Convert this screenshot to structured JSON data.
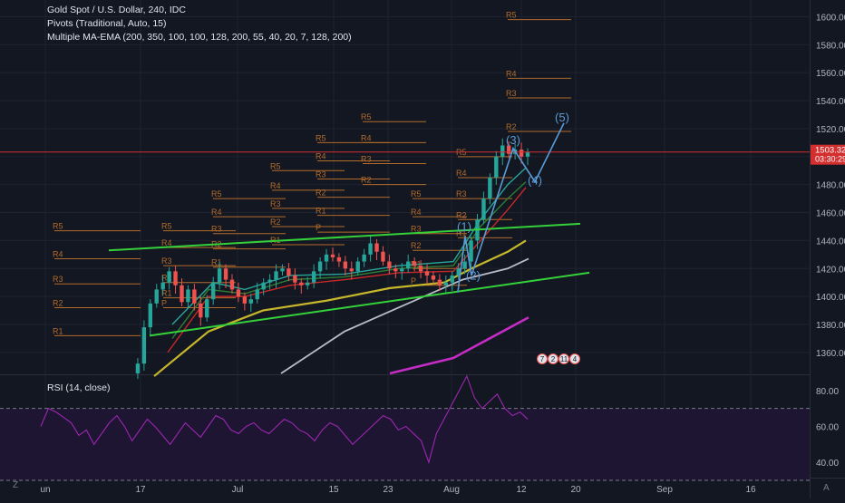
{
  "legend": {
    "symbol": "Gold Spot / U.S. Dollar, 240, IDC",
    "pivots": "Pivots (Traditional, Auto, 15)",
    "ma": "Multiple MA-EMA (200, 350, 100, 100, 128, 200, 55, 40, 20, 7, 128, 200)"
  },
  "rsi_legend": "RSI (14, close)",
  "price_badge": {
    "price": "1503.32",
    "countdown": "03:30:29"
  },
  "corner": {
    "left": "Z",
    "right": "A"
  },
  "event_badges": [
    "7",
    "2",
    "11",
    "4"
  ],
  "colors": {
    "background": "#131722",
    "up": "#26a69a",
    "down": "#ef5350",
    "pivot": "#b36b2a",
    "trend_green": "#34d13a",
    "wave_blue": "#5b9bd5",
    "rsi_line": "#9c27b0"
  },
  "chart_data": [
    {
      "type": "line",
      "title": "Gold Spot / U.S. Dollar, 240, IDC",
      "y_ticks": [
        "1600.00",
        "1580.00",
        "1560.00",
        "1540.00",
        "1520.00",
        "1500.00",
        "1480.00",
        "1460.00",
        "1440.00",
        "1420.00",
        "1400.00",
        "1380.00",
        "1360.00"
      ],
      "ylim": [
        1345,
        1612
      ],
      "x_ticks": [
        "un",
        "17",
        "Jul",
        "15",
        "23",
        "Aug",
        "12",
        "20",
        "Sep",
        "16"
      ],
      "last_price": 1503.32,
      "close_series": [
        1345,
        1352,
        1378,
        1395,
        1405,
        1410,
        1418,
        1408,
        1396,
        1405,
        1395,
        1385,
        1398,
        1410,
        1420,
        1412,
        1405,
        1400,
        1395,
        1398,
        1405,
        1410,
        1412,
        1418,
        1420,
        1415,
        1410,
        1408,
        1410,
        1418,
        1425,
        1430,
        1428,
        1425,
        1420,
        1418,
        1425,
        1430,
        1438,
        1432,
        1425,
        1420,
        1418,
        1420,
        1425,
        1422,
        1418,
        1415,
        1412,
        1408,
        1410,
        1415,
        1420,
        1425,
        1440,
        1455,
        1470,
        1485,
        1500,
        1508,
        1502,
        1505,
        1500,
        1503
      ],
      "wave_labels": [
        "(1)",
        "(2)",
        "(3)",
        "(4)",
        "(5)"
      ],
      "wave_points": [
        [
          1425,
          1447
        ],
        [
          1413,
          1412
        ],
        [
          1501,
          1509
        ],
        [
          1481,
          1480
        ],
        [
          1522,
          1525
        ]
      ],
      "pivot_labels": [
        "R5",
        "R4",
        "R3",
        "R2",
        "R1",
        "P",
        "S1",
        "S2",
        "S3",
        "S4",
        "S5"
      ],
      "grid": true
    },
    {
      "type": "line",
      "title": "RSI (14, close)",
      "y_ticks": [
        "80.00",
        "60.00",
        "40.00"
      ],
      "ylim": [
        32,
        88
      ],
      "bands": [
        70,
        30
      ],
      "values": [
        60,
        70,
        68,
        65,
        62,
        55,
        58,
        50,
        56,
        62,
        66,
        60,
        52,
        58,
        64,
        60,
        55,
        50,
        56,
        62,
        58,
        54,
        60,
        66,
        64,
        58,
        56,
        60,
        62,
        58,
        56,
        60,
        64,
        62,
        58,
        56,
        52,
        58,
        62,
        60,
        55,
        50,
        54,
        58,
        62,
        66,
        64,
        58,
        60,
        56,
        52,
        40,
        56,
        64,
        72,
        80,
        88,
        76,
        70,
        74,
        78,
        70,
        66,
        68,
        64
      ]
    }
  ]
}
